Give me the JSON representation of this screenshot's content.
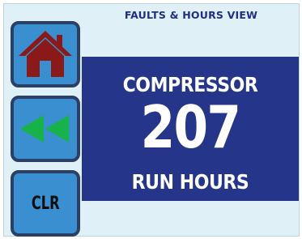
{
  "header": {
    "title": "FAULTS & HOURS VIEW"
  },
  "buttons": {
    "home_icon": "home-icon",
    "back_icon": "rewind-icon",
    "clear_label": "CLR"
  },
  "display": {
    "label_top": "COMPRESSOR",
    "value": "207",
    "label_bottom": "RUN HOURS"
  },
  "colors": {
    "screen_bg": "#dff1f7",
    "button_bg": "#3a8fd0",
    "button_border": "#2c3f66",
    "panel_bg": "#25368a",
    "title_text": "#1f2f86",
    "home_icon": "#8a1a1a",
    "rewind_icon": "#17b24a"
  }
}
